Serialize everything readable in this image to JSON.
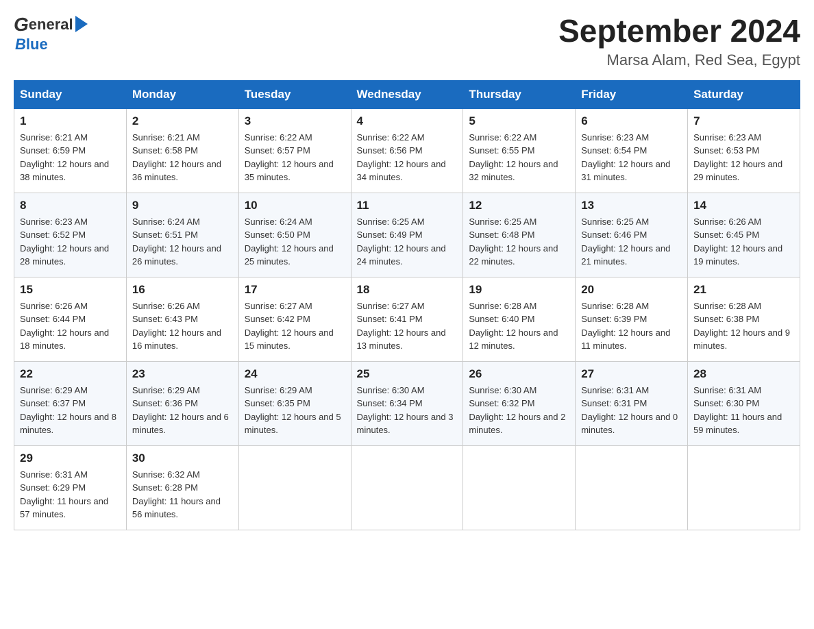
{
  "header": {
    "title": "September 2024",
    "subtitle": "Marsa Alam, Red Sea, Egypt"
  },
  "days_of_week": [
    "Sunday",
    "Monday",
    "Tuesday",
    "Wednesday",
    "Thursday",
    "Friday",
    "Saturday"
  ],
  "weeks": [
    [
      {
        "day": "1",
        "sunrise": "6:21 AM",
        "sunset": "6:59 PM",
        "daylight": "12 hours and 38 minutes."
      },
      {
        "day": "2",
        "sunrise": "6:21 AM",
        "sunset": "6:58 PM",
        "daylight": "12 hours and 36 minutes."
      },
      {
        "day": "3",
        "sunrise": "6:22 AM",
        "sunset": "6:57 PM",
        "daylight": "12 hours and 35 minutes."
      },
      {
        "day": "4",
        "sunrise": "6:22 AM",
        "sunset": "6:56 PM",
        "daylight": "12 hours and 34 minutes."
      },
      {
        "day": "5",
        "sunrise": "6:22 AM",
        "sunset": "6:55 PM",
        "daylight": "12 hours and 32 minutes."
      },
      {
        "day": "6",
        "sunrise": "6:23 AM",
        "sunset": "6:54 PM",
        "daylight": "12 hours and 31 minutes."
      },
      {
        "day": "7",
        "sunrise": "6:23 AM",
        "sunset": "6:53 PM",
        "daylight": "12 hours and 29 minutes."
      }
    ],
    [
      {
        "day": "8",
        "sunrise": "6:23 AM",
        "sunset": "6:52 PM",
        "daylight": "12 hours and 28 minutes."
      },
      {
        "day": "9",
        "sunrise": "6:24 AM",
        "sunset": "6:51 PM",
        "daylight": "12 hours and 26 minutes."
      },
      {
        "day": "10",
        "sunrise": "6:24 AM",
        "sunset": "6:50 PM",
        "daylight": "12 hours and 25 minutes."
      },
      {
        "day": "11",
        "sunrise": "6:25 AM",
        "sunset": "6:49 PM",
        "daylight": "12 hours and 24 minutes."
      },
      {
        "day": "12",
        "sunrise": "6:25 AM",
        "sunset": "6:48 PM",
        "daylight": "12 hours and 22 minutes."
      },
      {
        "day": "13",
        "sunrise": "6:25 AM",
        "sunset": "6:46 PM",
        "daylight": "12 hours and 21 minutes."
      },
      {
        "day": "14",
        "sunrise": "6:26 AM",
        "sunset": "6:45 PM",
        "daylight": "12 hours and 19 minutes."
      }
    ],
    [
      {
        "day": "15",
        "sunrise": "6:26 AM",
        "sunset": "6:44 PM",
        "daylight": "12 hours and 18 minutes."
      },
      {
        "day": "16",
        "sunrise": "6:26 AM",
        "sunset": "6:43 PM",
        "daylight": "12 hours and 16 minutes."
      },
      {
        "day": "17",
        "sunrise": "6:27 AM",
        "sunset": "6:42 PM",
        "daylight": "12 hours and 15 minutes."
      },
      {
        "day": "18",
        "sunrise": "6:27 AM",
        "sunset": "6:41 PM",
        "daylight": "12 hours and 13 minutes."
      },
      {
        "day": "19",
        "sunrise": "6:28 AM",
        "sunset": "6:40 PM",
        "daylight": "12 hours and 12 minutes."
      },
      {
        "day": "20",
        "sunrise": "6:28 AM",
        "sunset": "6:39 PM",
        "daylight": "12 hours and 11 minutes."
      },
      {
        "day": "21",
        "sunrise": "6:28 AM",
        "sunset": "6:38 PM",
        "daylight": "12 hours and 9 minutes."
      }
    ],
    [
      {
        "day": "22",
        "sunrise": "6:29 AM",
        "sunset": "6:37 PM",
        "daylight": "12 hours and 8 minutes."
      },
      {
        "day": "23",
        "sunrise": "6:29 AM",
        "sunset": "6:36 PM",
        "daylight": "12 hours and 6 minutes."
      },
      {
        "day": "24",
        "sunrise": "6:29 AM",
        "sunset": "6:35 PM",
        "daylight": "12 hours and 5 minutes."
      },
      {
        "day": "25",
        "sunrise": "6:30 AM",
        "sunset": "6:34 PM",
        "daylight": "12 hours and 3 minutes."
      },
      {
        "day": "26",
        "sunrise": "6:30 AM",
        "sunset": "6:32 PM",
        "daylight": "12 hours and 2 minutes."
      },
      {
        "day": "27",
        "sunrise": "6:31 AM",
        "sunset": "6:31 PM",
        "daylight": "12 hours and 0 minutes."
      },
      {
        "day": "28",
        "sunrise": "6:31 AM",
        "sunset": "6:30 PM",
        "daylight": "11 hours and 59 minutes."
      }
    ],
    [
      {
        "day": "29",
        "sunrise": "6:31 AM",
        "sunset": "6:29 PM",
        "daylight": "11 hours and 57 minutes."
      },
      {
        "day": "30",
        "sunrise": "6:32 AM",
        "sunset": "6:28 PM",
        "daylight": "11 hours and 56 minutes."
      },
      null,
      null,
      null,
      null,
      null
    ]
  ]
}
